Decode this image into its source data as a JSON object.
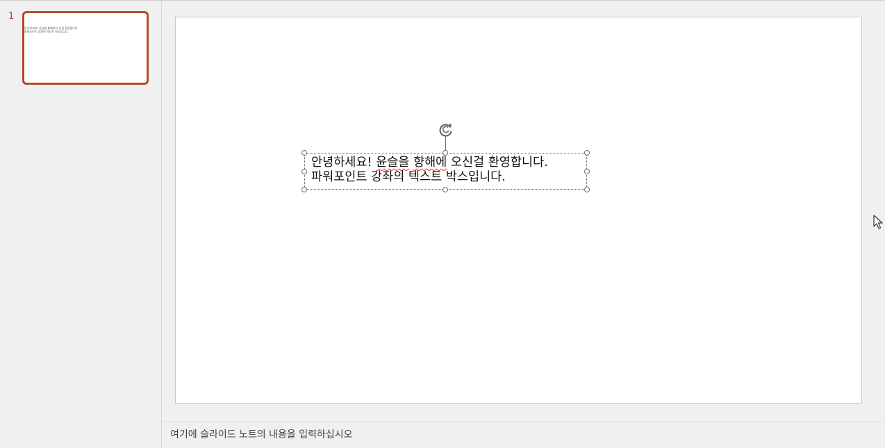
{
  "thumbnails": {
    "items": [
      {
        "number": "1",
        "preview_lines": [
          "안녕하세요! 윤슬을 향해에 오신걸 환영합니다.",
          "파워포인트 강좌의 텍스트 박스입니다."
        ],
        "selected": true
      }
    ]
  },
  "slide": {
    "textbox": {
      "line1_pre": "안녕하세요! ",
      "line1_spell": "윤슬을",
      "line1_mid": " ",
      "line1_spell2": "향해에",
      "line1_post": " 오신걸 환영합니다.",
      "line2": "파워포인트 강좌의 텍스트 박스입니다."
    },
    "spellcheck_color": "#e0392b"
  },
  "notes": {
    "placeholder": "여기에 슬라이드 노트의 내용을 입력하십시오"
  },
  "colors": {
    "accent": "#b7472a",
    "workspace_bg": "#f0f0f0",
    "slide_bg": "#ffffff"
  },
  "icons": {
    "rotate": "rotate-handle-icon",
    "cursor": "mouse-pointer-icon"
  }
}
